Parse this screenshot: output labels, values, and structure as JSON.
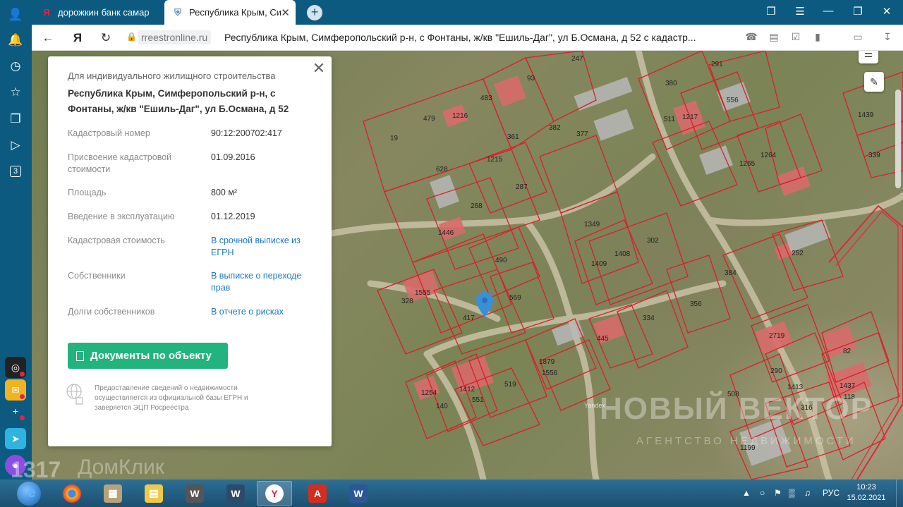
{
  "browser": {
    "tabs": [
      {
        "title": "дорожкин банк самара —",
        "favicon": "yandex-icon",
        "active": false
      },
      {
        "title": "Республика Крым, Сим",
        "favicon": "rosreestr-shield-icon",
        "active": true
      }
    ],
    "sidebar_badge": "3",
    "address": {
      "domain": "rreestronline.ru",
      "title": "Республика Крым, Симферопольский р-н, с Фонтаны, ж/кв \"Ешиль-Даг\", ул Б.Османа, д 52 с кадастр..."
    }
  },
  "panel": {
    "kind": "Для индивидуального жилищного строительства",
    "address": "Республика Крым, Симферопольский р-н, с Фонтаны, ж/кв \"Ешиль-Даг\", ул Б.Османа, д 52",
    "rows": [
      {
        "label": "Кадастровый номер",
        "value": "90:12:200702:417",
        "link": false
      },
      {
        "label": "Присвоение кадастровой стоимости",
        "value": "01.09.2016",
        "link": false
      },
      {
        "label": "Площадь",
        "value": "800 м²",
        "link": false
      },
      {
        "label": "Введение в эксплуатацию",
        "value": "01.12.2019",
        "link": false
      },
      {
        "label": "Кадастровая стоимость",
        "value": "В срочной выписке из ЕГРН",
        "link": true
      },
      {
        "label": "Собственники",
        "value": "В выписке о переходе прав",
        "link": true
      },
      {
        "label": "Долги собственников",
        "value": "В отчете о рисках",
        "link": true
      }
    ],
    "docs_button": "Документы по объекту",
    "footer": "Предоставление сведений о недвижимости осуществляется из официальной базы ЕГРН и заверяется ЭЦП Росреестра"
  },
  "map": {
    "parcel_numbers": [
      "247",
      "291",
      "93",
      "380",
      "483",
      "1216",
      "556",
      "479",
      "19",
      "361",
      "382",
      "377",
      "511",
      "1217",
      "1439",
      "339",
      "628",
      "1215",
      "1264",
      "1265",
      "287",
      "268",
      "1446",
      "1349",
      "302",
      "1408",
      "1409",
      "490",
      "252",
      "384",
      "328",
      "1555",
      "569",
      "417",
      "356",
      "334",
      "445",
      "2719",
      "82",
      "1879",
      "1556",
      "519",
      "1412",
      "1254",
      "140",
      "551",
      "290",
      "1413",
      "1437",
      "118",
      "508",
      "316",
      "1199"
    ],
    "watermark_main": "НОВЫЙ ВЕКТОР",
    "watermark_sub": "АГЕНТСТВО НЕДВИЖИМОСТИ",
    "provider": "Yandex",
    "domclick_watermark": "ДомКлик",
    "corner_numbers": "1317"
  },
  "taskbar": {
    "lang": "РУС",
    "time": "10:23",
    "date": "15.02.2021"
  }
}
